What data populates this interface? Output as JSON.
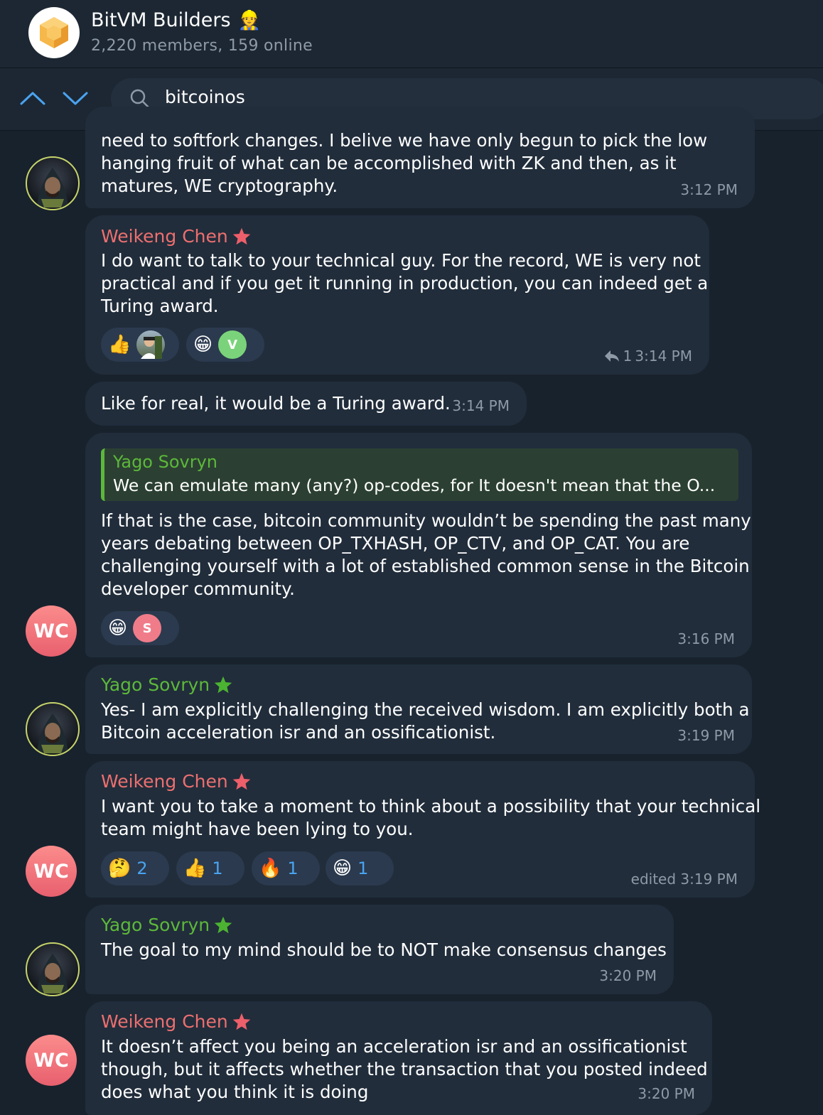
{
  "header": {
    "title": "BitVM Builders",
    "title_emoji": "👷",
    "subtitle": "2,220 members, 159 online"
  },
  "search": {
    "query": "bitcoinos"
  },
  "messages": [
    {
      "text": "need to softfork changes. I belive we have only begun to pick the low\nhanging fruit of what can be accomplished with ZK and then, as it\nmatures, WE cryptography.",
      "time": "3:12 PM"
    },
    {
      "sender": "Weikeng Chen",
      "text": "I do want to talk to your technical guy. For the record, WE is very not\npractical and if you get it running in production, you can indeed get a\nTuring award.",
      "reply_count": "1",
      "time": "3:14 PM",
      "reactions": [
        {
          "emoji": "👍"
        },
        {
          "emoji": "😁",
          "avatar_letter": "V"
        }
      ]
    },
    {
      "text": "Like for real, it would be a Turing award.",
      "time": "3:14 PM"
    },
    {
      "quote_name": "Yago Sovryn",
      "quote_text": "We can emulate many (any?) op-codes, for It doesn't mean that the O...",
      "text": "If that is the case, bitcoin community wouldn’t be spending the past many\nyears debating between OP_TXHASH, OP_CTV, and OP_CAT. You are\nchallenging yourself with a lot of established common sense in the Bitcoin\ndeveloper community.",
      "time": "3:16 PM",
      "reactions": [
        {
          "emoji": "😁",
          "avatar_letter": "S"
        }
      ],
      "avatar_initials": "WC"
    },
    {
      "sender": "Yago Sovryn",
      "text": "Yes- I am explicitly challenging the received wisdom. I am explicitly both a\nBitcoin acceleration isr and an ossificationist.",
      "time": "3:19 PM"
    },
    {
      "sender": "Weikeng Chen",
      "text": "I want you to take a moment to think about a possibility that your technical\nteam might have been lying to you.",
      "time": "edited 3:19 PM",
      "avatar_initials": "WC",
      "reactions": [
        {
          "emoji": "🤔",
          "count": "2"
        },
        {
          "emoji": "👍",
          "count": "1"
        },
        {
          "emoji": "🔥",
          "count": "1"
        },
        {
          "emoji": "😁",
          "count": "1"
        }
      ]
    },
    {
      "sender": "Yago Sovryn",
      "text": "The goal to my mind should be to NOT make consensus changes",
      "time": "3:20 PM"
    },
    {
      "sender": "Weikeng Chen",
      "text": "It doesn’t affect you being an acceleration isr and an ossificationist\nthough, but it affects whether the transaction that you posted indeed\ndoes what you think it is doing",
      "time": "3:20 PM",
      "avatar_initials": "WC"
    }
  ],
  "colors": {
    "background": "#18222d",
    "bubble": "#212d3b",
    "accent": "#4aa3f0",
    "red_name": "#ed6f6f",
    "green_name": "#5cb83a"
  }
}
